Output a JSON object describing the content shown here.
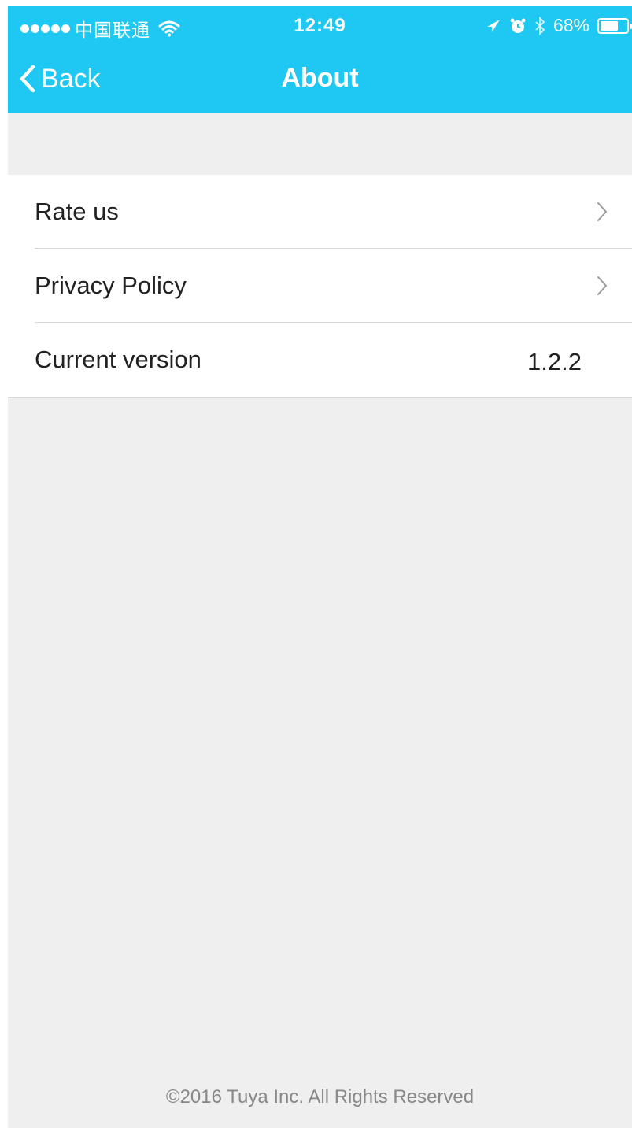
{
  "colors": {
    "header": "#1ec8f2",
    "body_bg": "#efefef",
    "text": "#222222",
    "footer_text": "#888888"
  },
  "status_bar": {
    "signal_dots": 5,
    "carrier": "中国联通",
    "time": "12:49",
    "battery_percent": "68%",
    "battery_level": 0.68,
    "icons": [
      "wifi-icon",
      "location-arrow-icon",
      "alarm-icon",
      "bluetooth-icon",
      "battery-icon"
    ]
  },
  "nav": {
    "back_label": "Back",
    "title": "About"
  },
  "rows": [
    {
      "label": "Rate us",
      "icon": "chevron-right-icon"
    },
    {
      "label": "Privacy Policy",
      "icon": "chevron-right-icon"
    },
    {
      "label": "Current version",
      "value": "1.2.2"
    }
  ],
  "footer": {
    "text": "©2016 Tuya Inc. All Rights Reserved"
  }
}
